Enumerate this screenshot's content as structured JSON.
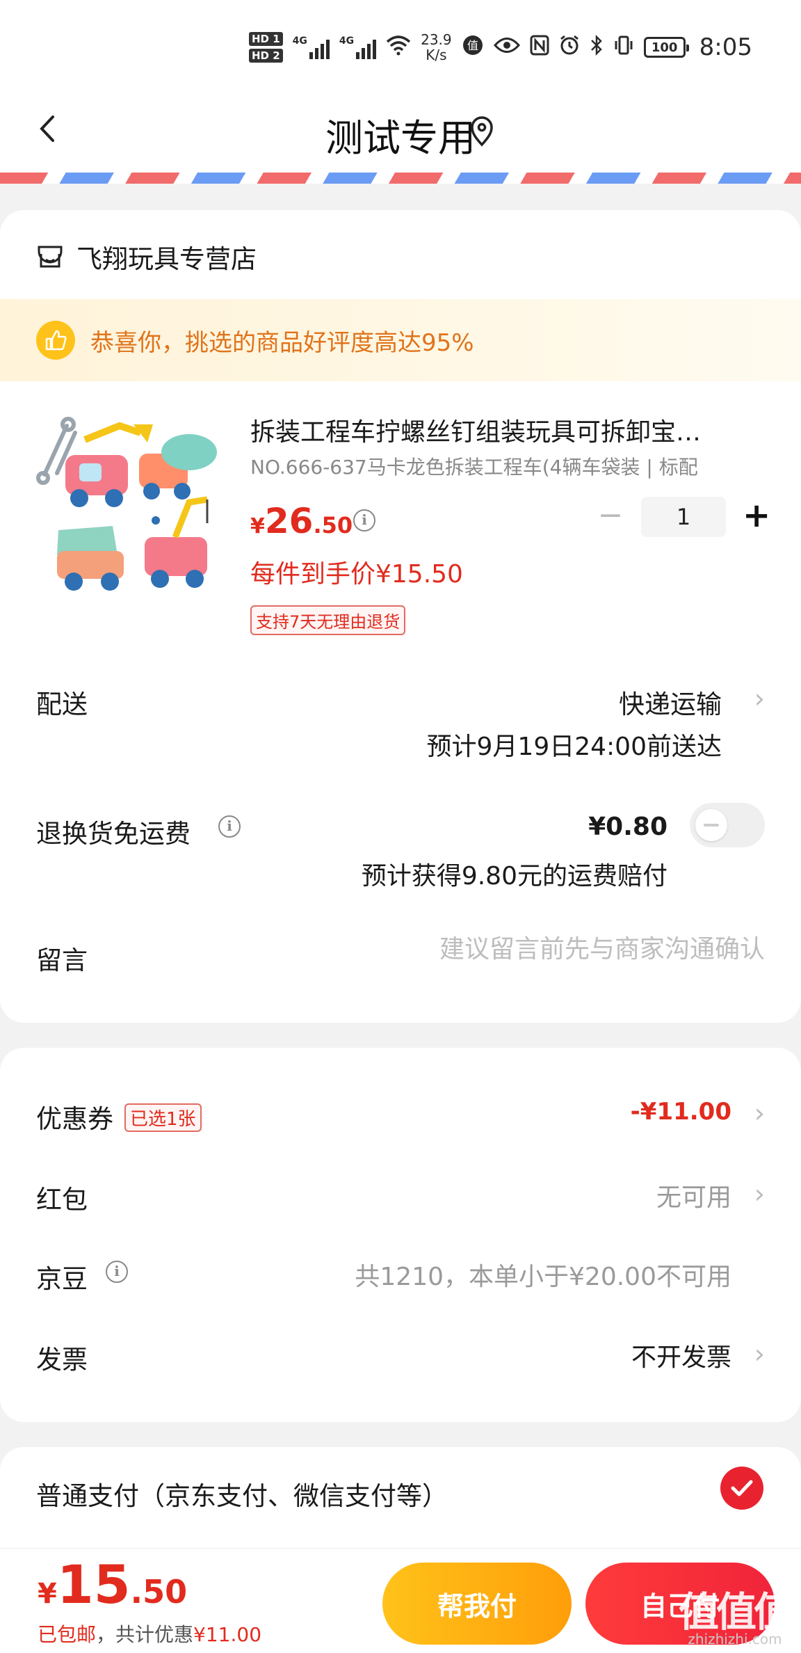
{
  "status_bar": {
    "hd1": "HD 1",
    "hd2": "HD 2",
    "net1": "4G",
    "net2": "4G",
    "speed_value": "23.9",
    "speed_unit": "K/s",
    "battery": "100",
    "time": "8:05"
  },
  "header": {
    "back_icon": "chevron-left-icon",
    "title": "测试专用",
    "location_icon": "location-pin-icon"
  },
  "shop": {
    "icon": "store-icon",
    "name": "飞翔玩具专营店"
  },
  "praise_banner": {
    "icon": "thumbs-up-icon",
    "text": "恭喜你，挑选的商品好评度高达95%"
  },
  "product": {
    "title": "拆装工程车拧螺丝钉组装玩具可拆卸宝…",
    "spec": "NO.666-637马卡龙色拆装工程车(4辆车袋装 | 标配",
    "price_symbol": "¥",
    "price_int": "26",
    "price_dec": ".50",
    "quantity": "1",
    "unit_price": "每件到手价¥15.50",
    "return_tag": "支持7天无理由退货"
  },
  "delivery": {
    "label": "配送",
    "method": "快递运输",
    "eta": "预计9月19日24:00前送达"
  },
  "return_shipping": {
    "label": "退换货免运费",
    "price": "¥0.80",
    "compensation": "预计获得9.80元的运费赔付",
    "enabled": false
  },
  "note": {
    "label": "留言",
    "placeholder": "建议留言前先与商家沟通确认",
    "value": ""
  },
  "discounts": {
    "coupon_label": "优惠券",
    "coupon_tag": "已选1张",
    "coupon_value": "-¥11.00",
    "redpacket_label": "红包",
    "redpacket_value": "无可用",
    "bean_label": "京豆",
    "bean_value": "共1210，本单小于¥20.00不可用",
    "invoice_label": "发票",
    "invoice_value": "不开发票"
  },
  "payment": {
    "method_label": "普通支付（京东支付、微信支付等）",
    "selected": true
  },
  "footer": {
    "total_symbol": "¥",
    "total_int": "15",
    "total_dec": ".50",
    "free_shipping": "已包邮",
    "discount_prefix": "，共计优惠",
    "discount_value": "¥11.00",
    "help_pay_label": "帮我付",
    "self_pay_label": "自己付",
    "watermark": "值",
    "watermark_site": "zhizhizhi.com"
  },
  "colors": {
    "accent_red": "#e12b1e",
    "gold": "#ffc21a",
    "orange_text": "#e0731a"
  }
}
